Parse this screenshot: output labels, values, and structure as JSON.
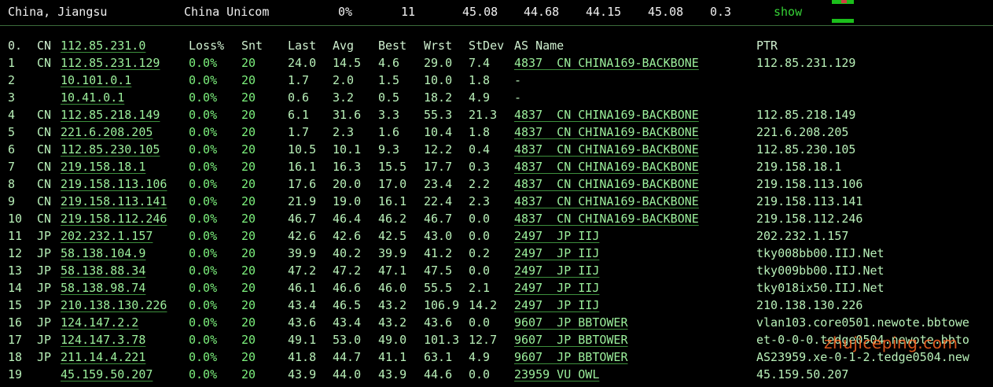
{
  "summary": {
    "location": "China, Jiangsu",
    "isp": "China Unicom",
    "loss": "0%",
    "sent": "11",
    "last": "45.08",
    "avg": "44.68",
    "best": "44.15",
    "worst": "45.08",
    "stdev": "0.3",
    "show_label": "show",
    "accent": "#36d236"
  },
  "columns": {
    "idx": "0.",
    "cc": "CN",
    "host": "112.85.231.0",
    "loss": "Loss%",
    "snt": "Snt",
    "last": "Last",
    "avg": "Avg",
    "best": "Best",
    "wrst": "Wrst",
    "stdev": "StDev",
    "as": "AS Name",
    "ptr": "PTR"
  },
  "hops": [
    {
      "idx": "1",
      "cc": "CN",
      "host": "112.85.231.129",
      "loss": "0.0%",
      "snt": "20",
      "last": "24.0",
      "avg": "14.5",
      "best": "4.6",
      "wrst": "29.0",
      "stdev": "7.4",
      "as": "4837  CN CHINA169-BACKBONE",
      "ptr": "112.85.231.129"
    },
    {
      "idx": "2",
      "cc": "",
      "host": "10.101.0.1",
      "loss": "0.0%",
      "snt": "20",
      "last": "1.7",
      "avg": "2.0",
      "best": "1.5",
      "wrst": "10.0",
      "stdev": "1.8",
      "as": "-",
      "ptr": ""
    },
    {
      "idx": "3",
      "cc": "",
      "host": "10.41.0.1",
      "loss": "0.0%",
      "snt": "20",
      "last": "0.6",
      "avg": "3.2",
      "best": "0.5",
      "wrst": "18.2",
      "stdev": "4.9",
      "as": "-",
      "ptr": ""
    },
    {
      "idx": "4",
      "cc": "CN",
      "host": "112.85.218.149",
      "loss": "0.0%",
      "snt": "20",
      "last": "6.1",
      "avg": "31.6",
      "best": "3.3",
      "wrst": "55.3",
      "stdev": "21.3",
      "as": "4837  CN CHINA169-BACKBONE",
      "ptr": "112.85.218.149"
    },
    {
      "idx": "5",
      "cc": "CN",
      "host": "221.6.208.205",
      "loss": "0.0%",
      "snt": "20",
      "last": "1.7",
      "avg": "2.3",
      "best": "1.6",
      "wrst": "10.4",
      "stdev": "1.8",
      "as": "4837  CN CHINA169-BACKBONE",
      "ptr": "221.6.208.205"
    },
    {
      "idx": "6",
      "cc": "CN",
      "host": "112.85.230.105",
      "loss": "0.0%",
      "snt": "20",
      "last": "10.5",
      "avg": "10.1",
      "best": "9.3",
      "wrst": "12.2",
      "stdev": "0.4",
      "as": "4837  CN CHINA169-BACKBONE",
      "ptr": "112.85.230.105"
    },
    {
      "idx": "7",
      "cc": "CN",
      "host": "219.158.18.1",
      "loss": "0.0%",
      "snt": "20",
      "last": "16.1",
      "avg": "16.3",
      "best": "15.5",
      "wrst": "17.7",
      "stdev": "0.3",
      "as": "4837  CN CHINA169-BACKBONE",
      "ptr": "219.158.18.1"
    },
    {
      "idx": "8",
      "cc": "CN",
      "host": "219.158.113.106",
      "loss": "0.0%",
      "snt": "20",
      "last": "17.6",
      "avg": "20.0",
      "best": "17.0",
      "wrst": "23.4",
      "stdev": "2.2",
      "as": "4837  CN CHINA169-BACKBONE",
      "ptr": "219.158.113.106"
    },
    {
      "idx": "9",
      "cc": "CN",
      "host": "219.158.113.141",
      "loss": "0.0%",
      "snt": "20",
      "last": "21.9",
      "avg": "19.0",
      "best": "16.1",
      "wrst": "22.4",
      "stdev": "2.3",
      "as": "4837  CN CHINA169-BACKBONE",
      "ptr": "219.158.113.141"
    },
    {
      "idx": "10",
      "cc": "CN",
      "host": "219.158.112.246",
      "loss": "0.0%",
      "snt": "20",
      "last": "46.7",
      "avg": "46.4",
      "best": "46.2",
      "wrst": "46.7",
      "stdev": "0.0",
      "as": "4837  CN CHINA169-BACKBONE",
      "ptr": "219.158.112.246"
    },
    {
      "idx": "11",
      "cc": "JP",
      "host": "202.232.1.157",
      "loss": "0.0%",
      "snt": "20",
      "last": "42.6",
      "avg": "42.6",
      "best": "42.5",
      "wrst": "43.0",
      "stdev": "0.0",
      "as": "2497  JP IIJ",
      "ptr": "202.232.1.157"
    },
    {
      "idx": "12",
      "cc": "JP",
      "host": "58.138.104.9",
      "loss": "0.0%",
      "snt": "20",
      "last": "39.9",
      "avg": "40.2",
      "best": "39.9",
      "wrst": "41.2",
      "stdev": "0.2",
      "as": "2497  JP IIJ",
      "ptr": "tky008bb00.IIJ.Net"
    },
    {
      "idx": "13",
      "cc": "JP",
      "host": "58.138.88.34",
      "loss": "0.0%",
      "snt": "20",
      "last": "47.2",
      "avg": "47.2",
      "best": "47.1",
      "wrst": "47.5",
      "stdev": "0.0",
      "as": "2497  JP IIJ",
      "ptr": "tky009bb00.IIJ.Net"
    },
    {
      "idx": "14",
      "cc": "JP",
      "host": "58.138.98.74",
      "loss": "0.0%",
      "snt": "20",
      "last": "46.1",
      "avg": "46.6",
      "best": "46.0",
      "wrst": "55.5",
      "stdev": "2.1",
      "as": "2497  JP IIJ",
      "ptr": "tky018ix50.IIJ.Net"
    },
    {
      "idx": "15",
      "cc": "JP",
      "host": "210.138.130.226",
      "loss": "0.0%",
      "snt": "20",
      "last": "43.4",
      "avg": "46.5",
      "best": "43.2",
      "wrst": "106.9",
      "stdev": "14.2",
      "as": "2497  JP IIJ",
      "ptr": "210.138.130.226"
    },
    {
      "idx": "16",
      "cc": "JP",
      "host": "124.147.2.2",
      "loss": "0.0%",
      "snt": "20",
      "last": "43.6",
      "avg": "43.4",
      "best": "43.2",
      "wrst": "43.6",
      "stdev": "0.0",
      "as": "9607  JP BBTOWER",
      "ptr": "vlan103.core0501.newote.bbtowe"
    },
    {
      "idx": "17",
      "cc": "JP",
      "host": "124.147.3.78",
      "loss": "0.0%",
      "snt": "20",
      "last": "49.1",
      "avg": "53.0",
      "best": "49.0",
      "wrst": "101.3",
      "stdev": "12.7",
      "as": "9607  JP BBTOWER",
      "ptr": "et-0-0-0.tedge0504.newote.bbto"
    },
    {
      "idx": "18",
      "cc": "JP",
      "host": "211.14.4.221",
      "loss": "0.0%",
      "snt": "20",
      "last": "41.8",
      "avg": "44.7",
      "best": "41.1",
      "wrst": "63.1",
      "stdev": "4.9",
      "as": "9607  JP BBTOWER",
      "ptr": "AS23959.xe-0-1-2.tedge0504.new"
    },
    {
      "idx": "19",
      "cc": "",
      "host": "45.159.50.207",
      "loss": "0.0%",
      "snt": "20",
      "last": "43.9",
      "avg": "44.0",
      "best": "43.9",
      "wrst": "44.6",
      "stdev": "0.0",
      "as": "23959 VU OWL",
      "ptr": "45.159.50.207"
    }
  ],
  "watermark": "zhujiceping.com"
}
